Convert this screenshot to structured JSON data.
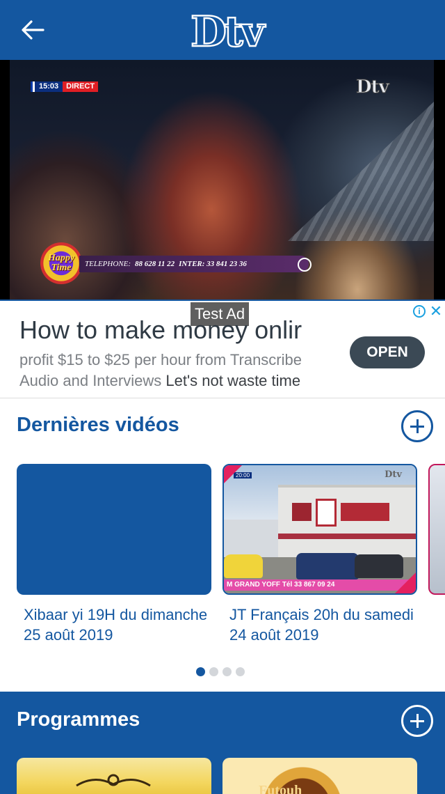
{
  "app_bar": {
    "logo_text": "Dtv",
    "brand_color": "#1457a0",
    "back_icon": "arrow-left-icon"
  },
  "player": {
    "osd_time": "15:03",
    "osd_live": "DIRECT",
    "channel_logo": "Dtv",
    "show_logo_line1": "Happy",
    "show_logo_line2": "Time",
    "ticker_label": "TELEPHONE:",
    "ticker_phone": "88 628 11 22",
    "ticker_inter": "INTER: 33 841 23 36"
  },
  "ad": {
    "label": "Test Ad",
    "headline": "How to make money onlir",
    "body_gray": "profit $15 to $25 per hour from Transcribe Audio and Interviews",
    "body_dark": "Let's not waste time",
    "cta": "OPEN",
    "info_icon": "info-icon",
    "close_icon": "close-icon"
  },
  "latest_videos": {
    "title": "Dernières vidéos",
    "more_icon": "plus-circle-icon",
    "items": [
      {
        "title": "Xibaar yi 19H du dimanche 25 août 2019"
      },
      {
        "title": "JT Français 20h  du samedi 24 août 2019",
        "thumb_ticker": "M GRAND YOFF Tél 33 867 09 24",
        "thumb_osd": "20:00",
        "thumb_logo": "Dtv"
      }
    ],
    "pager": {
      "count": 4,
      "active": 0
    }
  },
  "programmes": {
    "title": "Programmes",
    "more_icon": "plus-circle-icon",
    "items": [
      {
        "title": ""
      },
      {
        "title": "Futouh"
      }
    ]
  }
}
